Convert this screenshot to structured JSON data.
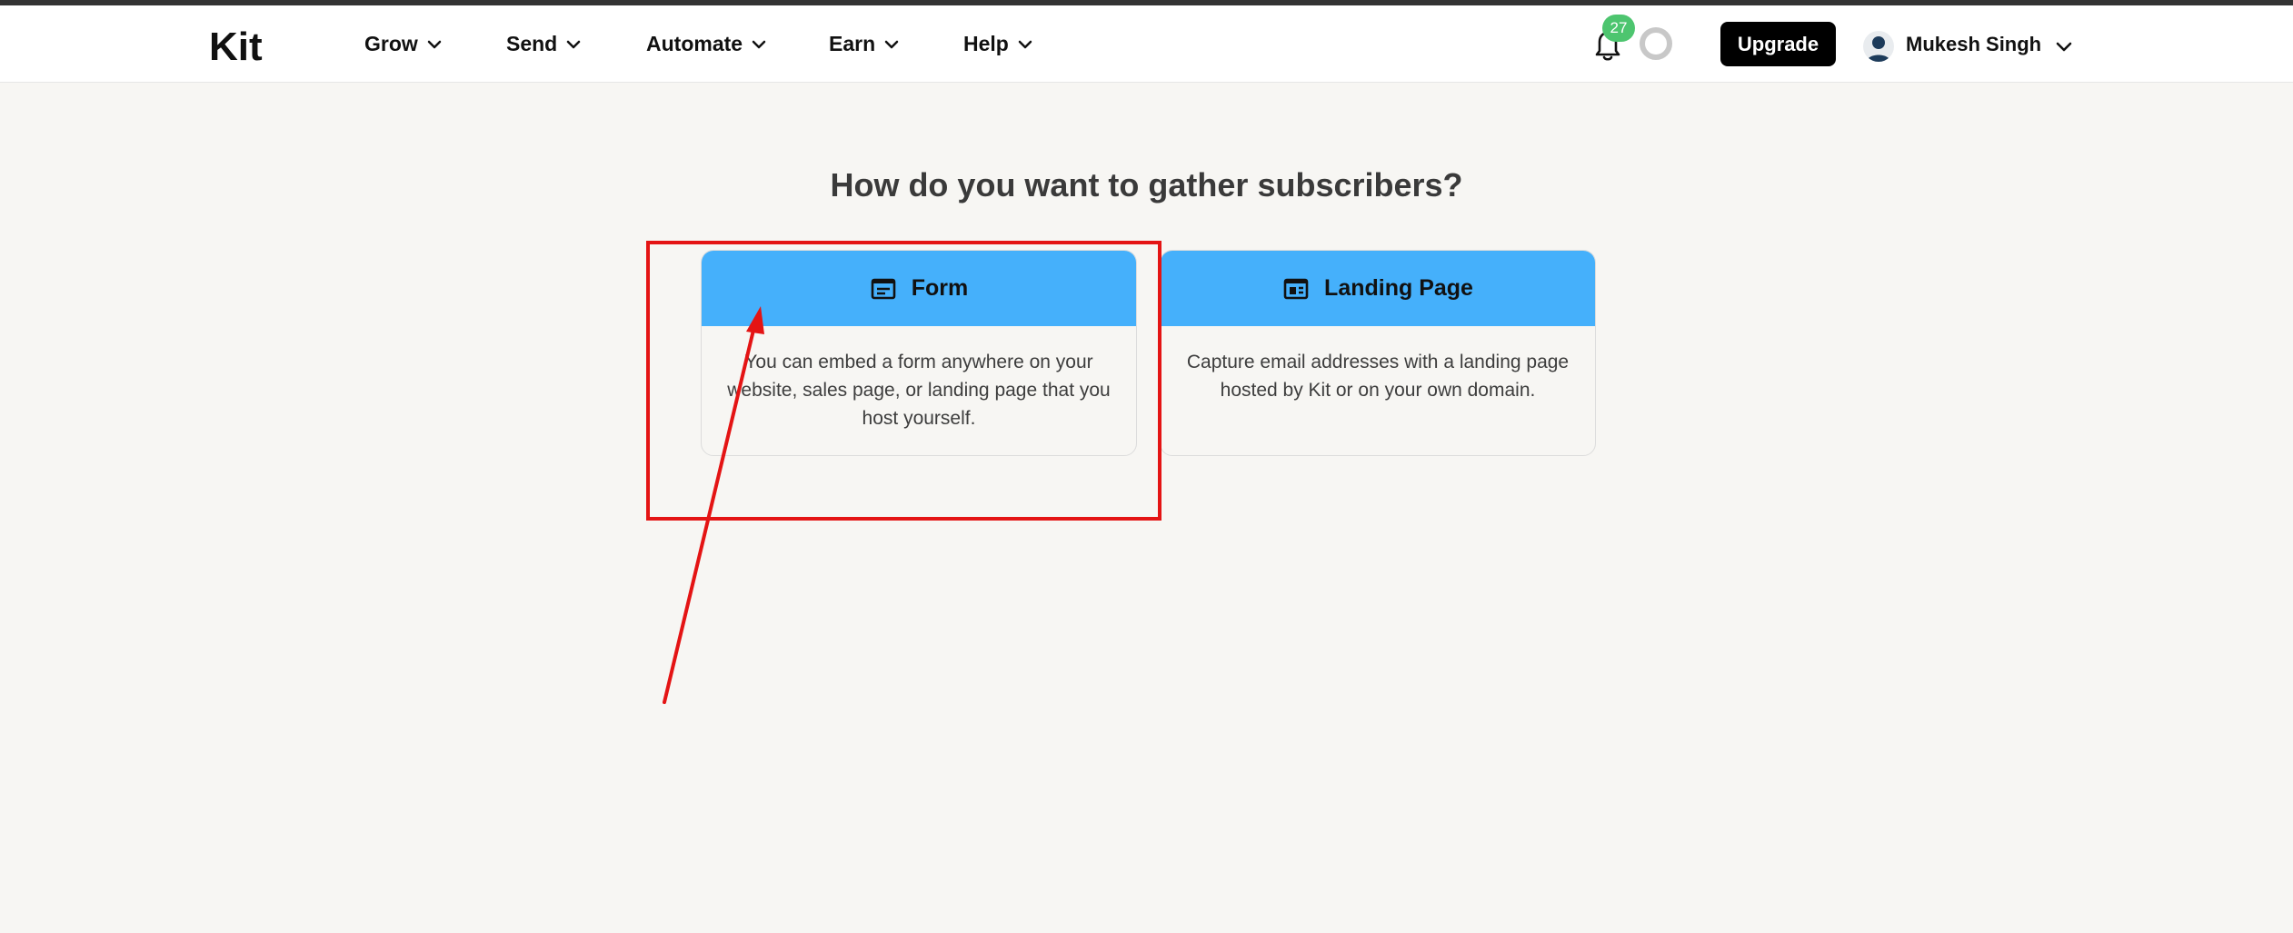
{
  "brand": {
    "logo": "Kit"
  },
  "nav": {
    "items": [
      {
        "label": "Grow"
      },
      {
        "label": "Send"
      },
      {
        "label": "Automate"
      },
      {
        "label": "Earn"
      },
      {
        "label": "Help"
      }
    ]
  },
  "notifications": {
    "count": "27",
    "badge_color": "#4dc56f"
  },
  "upgrade": {
    "label": "Upgrade"
  },
  "user": {
    "name": "Mukesh Singh"
  },
  "main": {
    "headline": "How do you want to gather subscribers?",
    "options": [
      {
        "title": "Form",
        "icon": "form-icon",
        "description": "You can embed a form anywhere on your website, sales page, or landing page that you host yourself."
      },
      {
        "title": "Landing Page",
        "icon": "landing-page-icon",
        "description": "Capture email addresses with a landing page hosted by Kit or on your own domain."
      }
    ]
  },
  "colors": {
    "accent": "#45b0fb",
    "annotation": "#e41414",
    "background": "#f7f6f3"
  }
}
